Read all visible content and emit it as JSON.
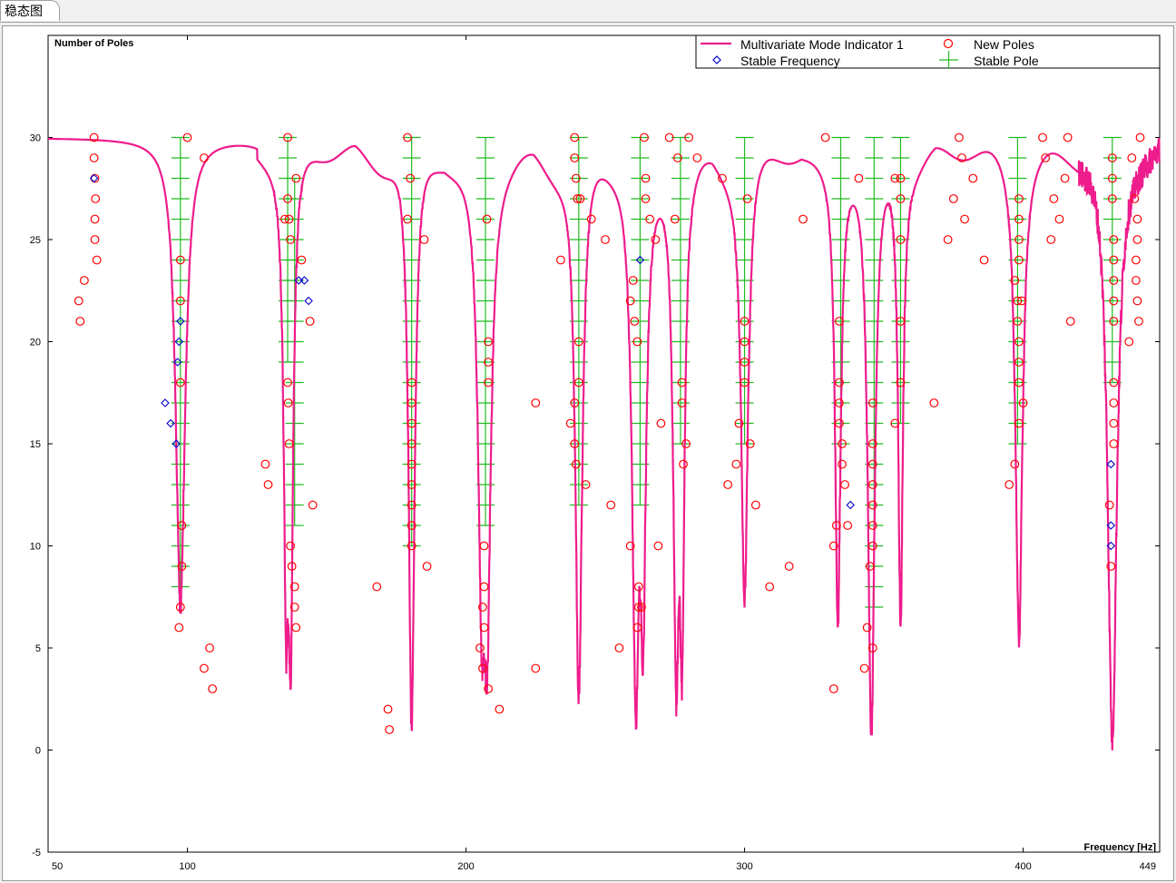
{
  "tab": {
    "label": "稳态图"
  },
  "colors": {
    "mmif": "#ee1c8c",
    "new_poles": "#ff0000",
    "stable_frequency": "#0000cc",
    "stable_pole": "#22bb22"
  },
  "chart_data": {
    "type": "scatter",
    "ylabel": "Number of Poles",
    "xlabel": "Frequency [Hz]",
    "xlim": [
      50,
      449
    ],
    "ylim": [
      -5,
      35
    ],
    "x_ticks": [
      50,
      100,
      200,
      300,
      400,
      449
    ],
    "y_ticks": [
      30,
      25,
      20,
      15,
      10,
      5,
      0,
      -5
    ],
    "grid": false,
    "legend_position": "top-right",
    "legend": {
      "mmif": "Multivariate Mode Indicator 1",
      "new_poles": "New Poles",
      "stable_frequency": "Stable Frequency",
      "stable_pole": "Stable Pole"
    },
    "mmif_baseline": 30,
    "mmif_dips": [
      {
        "freq": 97.5,
        "min": 7.0,
        "width": 2.0
      },
      {
        "freq": 135.5,
        "min": 6.0,
        "width": 1.0
      },
      {
        "freq": 137.0,
        "min": 3.8,
        "width": 1.0
      },
      {
        "freq": 180.5,
        "min": 1.1,
        "width": 1.3
      },
      {
        "freq": 205.8,
        "min": 6.5,
        "width": 1.5
      },
      {
        "freq": 207.5,
        "min": 5.0,
        "width": 1.5
      },
      {
        "freq": 240.5,
        "min": 2.6,
        "width": 1.5
      },
      {
        "freq": 261.0,
        "min": 1.5,
        "width": 1.5
      },
      {
        "freq": 263.5,
        "min": 5.5,
        "width": 1.2
      },
      {
        "freq": 275.5,
        "min": 2.8,
        "width": 1.2
      },
      {
        "freq": 277.5,
        "min": 4.0,
        "width": 1.0
      },
      {
        "freq": 300.0,
        "min": 7.8,
        "width": 1.5
      },
      {
        "freq": 333.5,
        "min": 6.5,
        "width": 1.2
      },
      {
        "freq": 345.5,
        "min": 0.8,
        "width": 1.5
      },
      {
        "freq": 356.0,
        "min": 6.5,
        "width": 1.0
      },
      {
        "freq": 398.5,
        "min": 5.6,
        "width": 1.5
      },
      {
        "freq": 432.0,
        "min": 0.5,
        "width": 2.0
      }
    ],
    "stable_pole_columns": [
      {
        "freq": 97.5,
        "from": 8,
        "to": 30
      },
      {
        "freq": 136.0,
        "from": 19,
        "to": 30
      },
      {
        "freq": 138.5,
        "from": 11,
        "to": 28
      },
      {
        "freq": 180.5,
        "from": 10,
        "to": 30
      },
      {
        "freq": 207.0,
        "from": 11,
        "to": 30
      },
      {
        "freq": 240.5,
        "from": 12,
        "to": 30
      },
      {
        "freq": 262.5,
        "from": 12,
        "to": 30
      },
      {
        "freq": 277.0,
        "from": 15,
        "to": 30
      },
      {
        "freq": 300.0,
        "from": 15,
        "to": 30
      },
      {
        "freq": 334.5,
        "from": 15,
        "to": 30
      },
      {
        "freq": 346.5,
        "from": 7,
        "to": 30
      },
      {
        "freq": 356.0,
        "from": 16,
        "to": 30
      },
      {
        "freq": 398.0,
        "from": 15,
        "to": 30
      },
      {
        "freq": 432.0,
        "from": 18,
        "to": 30
      }
    ],
    "new_poles": [
      [
        66.5,
        30
      ],
      [
        66.5,
        29
      ],
      [
        66.8,
        28
      ],
      [
        67,
        27
      ],
      [
        66.8,
        26
      ],
      [
        66.8,
        25
      ],
      [
        67.5,
        24
      ],
      [
        63,
        23
      ],
      [
        61,
        22
      ],
      [
        61.5,
        21
      ],
      [
        97.5,
        24
      ],
      [
        97.5,
        22
      ],
      [
        97.5,
        18
      ],
      [
        98,
        11
      ],
      [
        98,
        9
      ],
      [
        97.5,
        7
      ],
      [
        97,
        6
      ],
      [
        100,
        30
      ],
      [
        106,
        29
      ],
      [
        106,
        4
      ],
      [
        108,
        5
      ],
      [
        109,
        3
      ],
      [
        128,
        14
      ],
      [
        129,
        13
      ],
      [
        136,
        30
      ],
      [
        135,
        26
      ],
      [
        136.5,
        26
      ],
      [
        137,
        25
      ],
      [
        139,
        28
      ],
      [
        136,
        27
      ],
      [
        136,
        18
      ],
      [
        136.2,
        17
      ],
      [
        136.5,
        15
      ],
      [
        137,
        10
      ],
      [
        137.5,
        9
      ],
      [
        138.5,
        8
      ],
      [
        138.5,
        7
      ],
      [
        139,
        6
      ],
      [
        141,
        24
      ],
      [
        144,
        21
      ],
      [
        145,
        12
      ],
      [
        168,
        8
      ],
      [
        172,
        2
      ],
      [
        172.5,
        1
      ],
      [
        179,
        30
      ],
      [
        179,
        26
      ],
      [
        180,
        28
      ],
      [
        180.5,
        18
      ],
      [
        180.5,
        17
      ],
      [
        180.5,
        16
      ],
      [
        180.5,
        15
      ],
      [
        180.5,
        14
      ],
      [
        180.5,
        13
      ],
      [
        180.5,
        12
      ],
      [
        180.5,
        11
      ],
      [
        180.5,
        10
      ],
      [
        185,
        25
      ],
      [
        186,
        9
      ],
      [
        205,
        5
      ],
      [
        206,
        4
      ],
      [
        206,
        7
      ],
      [
        206.5,
        6
      ],
      [
        206.5,
        8
      ],
      [
        206.5,
        10
      ],
      [
        207.5,
        26
      ],
      [
        208,
        3
      ],
      [
        208,
        20
      ],
      [
        208,
        19
      ],
      [
        208,
        18
      ],
      [
        212,
        2
      ],
      [
        225,
        17
      ],
      [
        225,
        4
      ],
      [
        234,
        24
      ],
      [
        237.5,
        16
      ],
      [
        239,
        30
      ],
      [
        239,
        29
      ],
      [
        239.5,
        28
      ],
      [
        240,
        27
      ],
      [
        240.5,
        20
      ],
      [
        240.5,
        18
      ],
      [
        239,
        17
      ],
      [
        239,
        15
      ],
      [
        239.5,
        14
      ],
      [
        241,
        27
      ],
      [
        243,
        13
      ],
      [
        245,
        26
      ],
      [
        250,
        25
      ],
      [
        252,
        12
      ],
      [
        255,
        5
      ],
      [
        259,
        22
      ],
      [
        259,
        10
      ],
      [
        260,
        23
      ],
      [
        260.5,
        21
      ],
      [
        261.5,
        20
      ],
      [
        262,
        8
      ],
      [
        261.5,
        6
      ],
      [
        262,
        7
      ],
      [
        263,
        7
      ],
      [
        264,
        30
      ],
      [
        264.5,
        28
      ],
      [
        264.5,
        27
      ],
      [
        266,
        26
      ],
      [
        268,
        25
      ],
      [
        269,
        10
      ],
      [
        270,
        16
      ],
      [
        273,
        30
      ],
      [
        275,
        26
      ],
      [
        276,
        29
      ],
      [
        277.5,
        18
      ],
      [
        277.5,
        17
      ],
      [
        278,
        14
      ],
      [
        279,
        15
      ],
      [
        280,
        30
      ],
      [
        283,
        29
      ],
      [
        292,
        28
      ],
      [
        294,
        13
      ],
      [
        297,
        14
      ],
      [
        298,
        16
      ],
      [
        300,
        21
      ],
      [
        300,
        20
      ],
      [
        300,
        19
      ],
      [
        300,
        18
      ],
      [
        301,
        27
      ],
      [
        302,
        15
      ],
      [
        304,
        12
      ],
      [
        309,
        8
      ],
      [
        316,
        9
      ],
      [
        321,
        26
      ],
      [
        329,
        30
      ],
      [
        332,
        3
      ],
      [
        332,
        10
      ],
      [
        333,
        11
      ],
      [
        334,
        21
      ],
      [
        334,
        18
      ],
      [
        334,
        17
      ],
      [
        334,
        16
      ],
      [
        335,
        15
      ],
      [
        335,
        14
      ],
      [
        336,
        13
      ],
      [
        337,
        11
      ],
      [
        341,
        28
      ],
      [
        343,
        4
      ],
      [
        344,
        6
      ],
      [
        345,
        9
      ],
      [
        346,
        17
      ],
      [
        346,
        15
      ],
      [
        346,
        14
      ],
      [
        346,
        13
      ],
      [
        346,
        12
      ],
      [
        346,
        11
      ],
      [
        346,
        10
      ],
      [
        346,
        5
      ],
      [
        354,
        28
      ],
      [
        354,
        16
      ],
      [
        356,
        28
      ],
      [
        356,
        27
      ],
      [
        356,
        25
      ],
      [
        356,
        21
      ],
      [
        356,
        18
      ],
      [
        368,
        17
      ],
      [
        373,
        25
      ],
      [
        375,
        27
      ],
      [
        377,
        30
      ],
      [
        378,
        29
      ],
      [
        379,
        26
      ],
      [
        382,
        28
      ],
      [
        386,
        24
      ],
      [
        395,
        13
      ],
      [
        397,
        14
      ],
      [
        397,
        23
      ],
      [
        398,
        22
      ],
      [
        398,
        21
      ],
      [
        398.5,
        27
      ],
      [
        398.5,
        26
      ],
      [
        398.5,
        25
      ],
      [
        398.5,
        24
      ],
      [
        398.5,
        20
      ],
      [
        398.5,
        19
      ],
      [
        398.5,
        18
      ],
      [
        398.5,
        16
      ],
      [
        399.5,
        22
      ],
      [
        400,
        17
      ],
      [
        407,
        30
      ],
      [
        408,
        29
      ],
      [
        410,
        25
      ],
      [
        411,
        27
      ],
      [
        413,
        26
      ],
      [
        415,
        28
      ],
      [
        416,
        30
      ],
      [
        417,
        21
      ],
      [
        431,
        12
      ],
      [
        431.5,
        9
      ],
      [
        432,
        29
      ],
      [
        432,
        28
      ],
      [
        432,
        27
      ],
      [
        432.5,
        25
      ],
      [
        432.5,
        24
      ],
      [
        432.5,
        23
      ],
      [
        432.5,
        22
      ],
      [
        432.5,
        21
      ],
      [
        432.5,
        18
      ],
      [
        432.5,
        17
      ],
      [
        432.5,
        16
      ],
      [
        432.5,
        15
      ],
      [
        438,
        20
      ],
      [
        439,
        29
      ],
      [
        440,
        27
      ],
      [
        440.5,
        24
      ],
      [
        440.5,
        23
      ],
      [
        441,
        26
      ],
      [
        441,
        25
      ],
      [
        441,
        22
      ],
      [
        441.5,
        21
      ],
      [
        442,
        30
      ]
    ],
    "stable_frequencies": [
      [
        66.5,
        28
      ],
      [
        92,
        17
      ],
      [
        94,
        16
      ],
      [
        96,
        15
      ],
      [
        96.5,
        19
      ],
      [
        97,
        20
      ],
      [
        97.5,
        21
      ],
      [
        140,
        23
      ],
      [
        142,
        23
      ],
      [
        143.5,
        22
      ],
      [
        262.5,
        24
      ],
      [
        338,
        12
      ],
      [
        431.5,
        14
      ],
      [
        431.5,
        11
      ],
      [
        431.5,
        10
      ]
    ]
  }
}
